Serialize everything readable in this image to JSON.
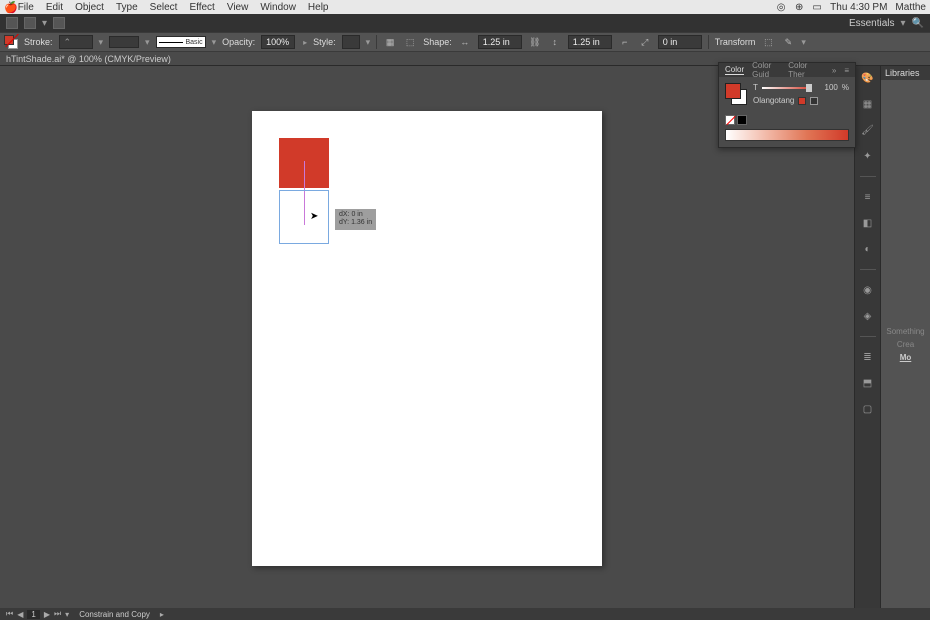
{
  "menubar": {
    "items": [
      "File",
      "Edit",
      "Object",
      "Type",
      "Select",
      "Effect",
      "View",
      "Window",
      "Help"
    ],
    "time": "Thu 4:30 PM",
    "user": "Matthe"
  },
  "workspace": {
    "label": "Essentials"
  },
  "controlbar": {
    "stroke_label": "Stroke:",
    "brush_label": "Basic",
    "opacity_label": "Opacity:",
    "opacity_value": "100%",
    "style_label": "Style:",
    "shape_label": "Shape:",
    "width_value": "1.25 in",
    "height_value": "1.25 in",
    "xy_value": "0 in",
    "transform_label": "Transform"
  },
  "doc": {
    "tab": "hTintShade.ai* @ 100% (CMYK/Preview)"
  },
  "smart_guide": {
    "dx": "dX: 0 in",
    "dy": "dY: 1.36 in"
  },
  "color_panel": {
    "tabs": [
      "Color",
      "Color Guid",
      "Color Ther"
    ],
    "tint_label": "T",
    "tint_value": "100",
    "tint_pct": "%",
    "swatch_name": "Olangotang"
  },
  "libraries": {
    "tab": "Libraries",
    "msg1": "Something",
    "msg2": "Crea",
    "link": "Mo"
  },
  "statusbar": {
    "artboard": "1",
    "hint": "Constrain and Copy"
  }
}
